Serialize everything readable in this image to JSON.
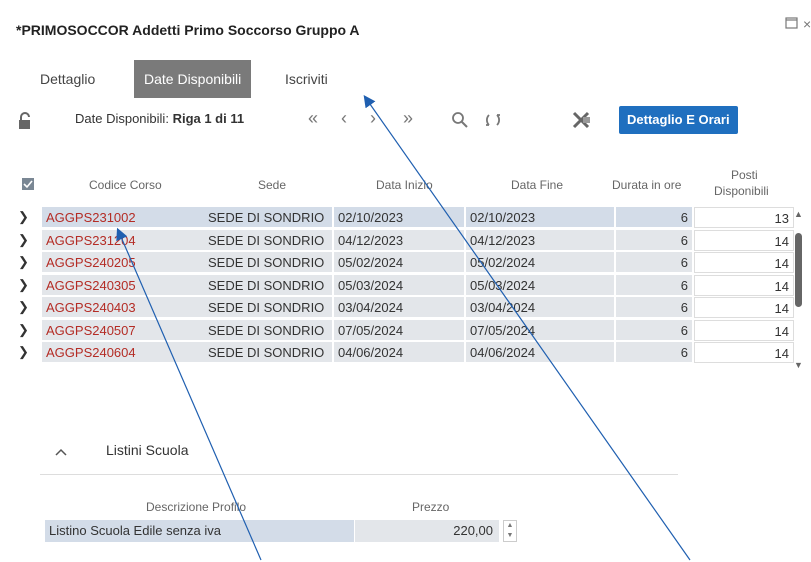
{
  "window": {
    "title": "*PRIMOSOCCOR Addetti Primo Soccorso Gruppo A"
  },
  "tabs": [
    "Dettaglio",
    "Date Disponibili",
    "Iscriviti"
  ],
  "toolbar": {
    "label": "Date Disponibili:",
    "row_info": "Riga 1 di 11",
    "detail_button": "Dettaglio E Orari"
  },
  "table": {
    "headers": [
      "Codice Corso",
      "Sede",
      "Data Inizio",
      "Data Fine",
      "Durata in ore",
      "Posti",
      "Disponibili"
    ],
    "rows": [
      [
        "AGGPS231002",
        "SEDE DI SONDRIO",
        "02/10/2023",
        "02/10/2023",
        "6",
        "13"
      ],
      [
        "AGGPS231204",
        "SEDE DI SONDRIO",
        "04/12/2023",
        "04/12/2023",
        "6",
        "14"
      ],
      [
        "AGGPS240205",
        "SEDE DI SONDRIO",
        "05/02/2024",
        "05/02/2024",
        "6",
        "14"
      ],
      [
        "AGGPS240305",
        "SEDE DI SONDRIO",
        "05/03/2024",
        "05/03/2024",
        "6",
        "14"
      ],
      [
        "AGGPS240403",
        "SEDE DI SONDRIO",
        "03/04/2024",
        "03/04/2024",
        "6",
        "14"
      ],
      [
        "AGGPS240507",
        "SEDE DI SONDRIO",
        "07/05/2024",
        "07/05/2024",
        "6",
        "14"
      ],
      [
        "AGGPS240604",
        "SEDE DI SONDRIO",
        "04/06/2024",
        "04/06/2024",
        "6",
        "14"
      ]
    ]
  },
  "listini": {
    "title": "Listini Scuola",
    "headers": [
      "Descrizione Profilo",
      "Prezzo"
    ],
    "row": [
      "Listino Scuola Edile senza iva",
      "220,00"
    ]
  },
  "icons": {
    "lock": "unlock-icon",
    "first": "«",
    "prev": "‹",
    "next": "›",
    "last": "»",
    "search": "search-icon",
    "refresh": "refresh-icon",
    "excel": "excel-icon"
  },
  "colors": {
    "accent": "#1f6fbf",
    "active_tab": "#7a7a7a",
    "code_text": "#b42c25",
    "row_bg": "#e3e6ea",
    "selected_row_bg": "#d3dce8"
  }
}
